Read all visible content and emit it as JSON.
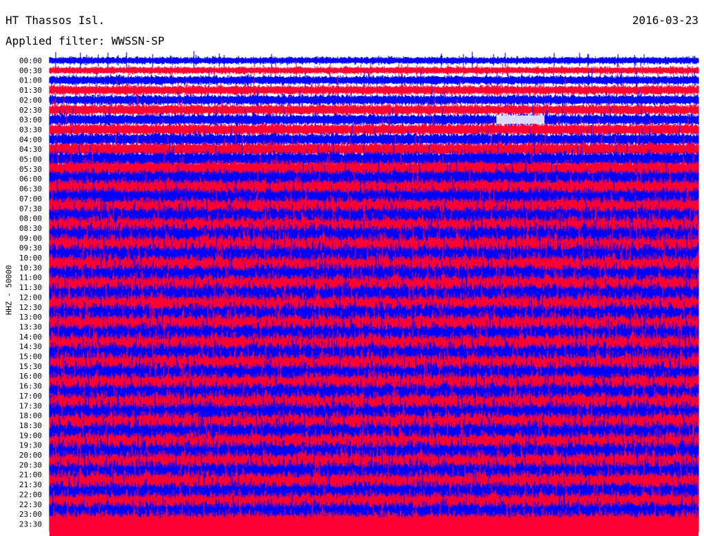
{
  "header": {
    "station": "HT Thassos Isl.",
    "date": "2016-03-23",
    "filter": "Applied filter: WWSSN-SP"
  },
  "chart_data": {
    "type": "helicorder",
    "title": "HT Thassos Isl.",
    "date": "2016-03-23",
    "filter": "WWSSN-SP",
    "channel_label": "HHZ - 50000",
    "row_interval_minutes": 30,
    "row_labels": [
      "00:00",
      "00:30",
      "01:00",
      "01:30",
      "02:00",
      "02:30",
      "03:00",
      "03:30",
      "04:00",
      "04:30",
      "05:00",
      "05:30",
      "06:00",
      "06:30",
      "07:00",
      "07:30",
      "08:00",
      "08:30",
      "09:00",
      "09:30",
      "10:00",
      "10:30",
      "11:00",
      "11:30",
      "12:00",
      "12:30",
      "13:00",
      "13:30",
      "14:00",
      "14:30",
      "15:00",
      "15:30",
      "16:00",
      "16:30",
      "17:00",
      "17:30",
      "18:00",
      "18:30",
      "19:00",
      "19:30",
      "20:00",
      "20:30",
      "21:00",
      "21:30",
      "22:00",
      "22:30",
      "23:00",
      "23:30"
    ],
    "trace_colors": [
      "#0000ff",
      "#ff0033"
    ],
    "gap_color": "#ffffff"
  }
}
